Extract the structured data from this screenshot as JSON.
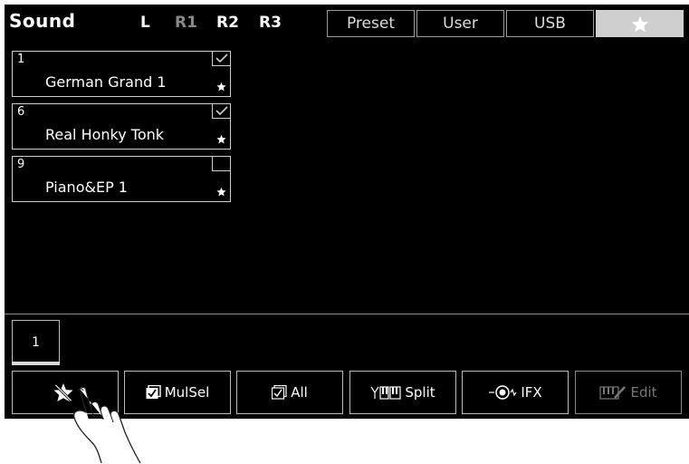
{
  "header": {
    "title": "Sound",
    "parts": [
      {
        "label": "L",
        "active": true
      },
      {
        "label": "R1",
        "active": false
      },
      {
        "label": "R2",
        "active": true
      },
      {
        "label": "R3",
        "active": true
      }
    ],
    "tabs": [
      {
        "label": "Preset",
        "selected": false
      },
      {
        "label": "User",
        "selected": false
      },
      {
        "label": "USB",
        "selected": false
      },
      {
        "label": "",
        "icon": "star-icon",
        "selected": true
      }
    ]
  },
  "favorites": [
    {
      "number": "1",
      "name": "German Grand 1",
      "checked": true
    },
    {
      "number": "6",
      "name": "Real Honky Tonk",
      "checked": true
    },
    {
      "number": "9",
      "name": "Piano&EP 1",
      "checked": false
    }
  ],
  "pager": {
    "current": "1"
  },
  "toolbar": {
    "buttons": [
      {
        "label": "",
        "icon": "unfavorite-star-icon",
        "enabled": true
      },
      {
        "label": "MulSel",
        "icon": "multi-select-icon",
        "enabled": true
      },
      {
        "label": "All",
        "icon": "select-all-icon",
        "enabled": true
      },
      {
        "label": "Split",
        "icon": "keyboard-split-icon",
        "enabled": true
      },
      {
        "label": "IFX",
        "icon": "effect-knob-icon",
        "enabled": true
      },
      {
        "label": "Edit",
        "icon": "edit-icon",
        "enabled": false
      }
    ]
  },
  "colors": {
    "background": "#000000",
    "border": "#cfcfcf",
    "selected_tab": "#cfcfcf",
    "inactive_text": "#8a8a8a"
  }
}
